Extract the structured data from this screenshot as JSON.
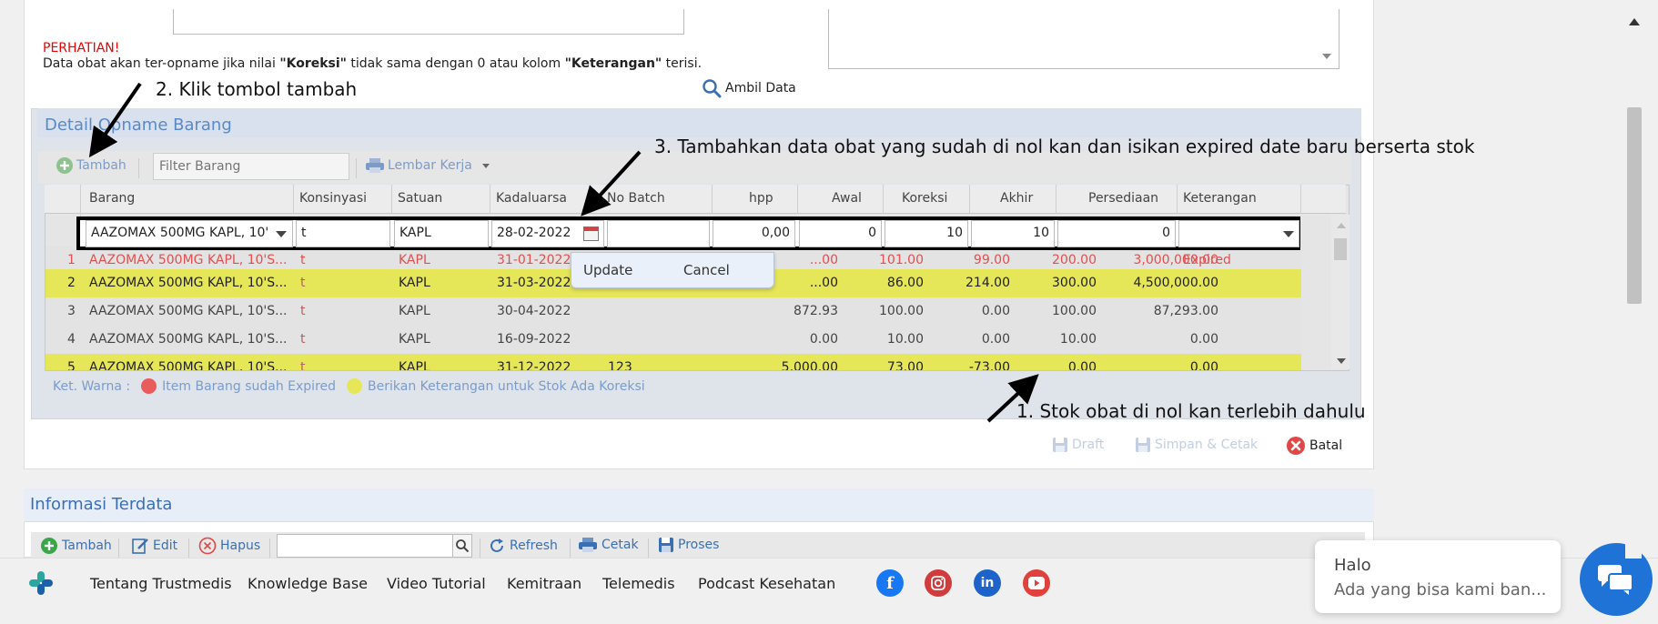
{
  "warning": {
    "title": "PERHATIAN!",
    "text_before": "Data obat akan ter-opname jika nilai ",
    "koreksi": "\"Koreksi\"",
    "text_mid": " tidak sama dengan 0 atau kolom ",
    "keterangan": "\"Keterangan\"",
    "text_after": " terisi."
  },
  "ambil_data_label": "Ambil Data",
  "detail": {
    "title": "Detail Opname Barang",
    "tambah_label": "Tambah",
    "filter_placeholder": "Filter Barang",
    "lembar_kerja_label": "Lembar Kerja"
  },
  "columns": [
    "Barang",
    "Konsinyasi",
    "Satuan",
    "Kadaluarsa",
    "No Batch",
    "hpp",
    "Awal",
    "Koreksi",
    "Akhir",
    "Persediaan",
    "Keterangan"
  ],
  "edit_row": {
    "barang": "AAZOMAX 500MG KAPL, 10'",
    "konsinyasi": "t",
    "satuan": "KAPL",
    "kadaluarsa": "28-02-2022",
    "no_batch": "",
    "hpp": "0,00",
    "awal": "0",
    "koreksi": "10",
    "akhir": "10",
    "persediaan": "0",
    "keterangan": ""
  },
  "popup": {
    "update": "Update",
    "cancel": "Cancel"
  },
  "rows": [
    {
      "no": "1",
      "barang": "AAZOMAX 500MG KAPL, 10'S...",
      "konsinyasi": "t",
      "satuan": "KAPL",
      "kadaluarsa": "31-01-2022",
      "no_batch": "",
      "hpp": "...00",
      "awal": "101.00",
      "koreksi": "99.00",
      "akhir": "200.00",
      "persediaan": "3,000,000.00",
      "keterangan": "Expired"
    },
    {
      "no": "2",
      "barang": "AAZOMAX 500MG KAPL, 10'S...",
      "konsinyasi": "t",
      "satuan": "KAPL",
      "kadaluarsa": "31-03-2022",
      "no_batch": "",
      "hpp": "...00",
      "awal": "86.00",
      "koreksi": "214.00",
      "akhir": "300.00",
      "persediaan": "4,500,000.00",
      "keterangan": ""
    },
    {
      "no": "3",
      "barang": "AAZOMAX 500MG KAPL, 10'S...",
      "konsinyasi": "t",
      "satuan": "KAPL",
      "kadaluarsa": "30-04-2022",
      "no_batch": "",
      "hpp": "872.93",
      "awal": "100.00",
      "koreksi": "0.00",
      "akhir": "100.00",
      "persediaan": "87,293.00",
      "keterangan": ""
    },
    {
      "no": "4",
      "barang": "AAZOMAX 500MG KAPL, 10'S...",
      "konsinyasi": "t",
      "satuan": "KAPL",
      "kadaluarsa": "16-09-2022",
      "no_batch": "",
      "hpp": "0.00",
      "awal": "10.00",
      "koreksi": "0.00",
      "akhir": "10.00",
      "persediaan": "0.00",
      "keterangan": ""
    },
    {
      "no": "5",
      "barang": "AAZOMAX 500MG KAPL, 10'S...",
      "konsinyasi": "t",
      "satuan": "KAPL",
      "kadaluarsa": "31-12-2022",
      "no_batch": "123",
      "hpp": "5,000.00",
      "awal": "73.00",
      "koreksi": "-73.00",
      "akhir": "0.00",
      "persediaan": "0.00",
      "keterangan": ""
    }
  ],
  "legend": {
    "prefix": "Ket. Warna :",
    "expired": "Item Barang sudah Expired",
    "koreksi": "Berikan Keterangan untuk Stok Ada Koreksi",
    "expired_color": "#e85c5c",
    "koreksi_color": "#e6e659"
  },
  "actions": {
    "draft": "Draft",
    "simpan": "Simpan & Cetak",
    "batal": "Batal"
  },
  "info": {
    "title": "Informasi Terdata",
    "tambah": "Tambah",
    "edit": "Edit",
    "hapus": "Hapus",
    "refresh": "Refresh",
    "cetak": "Cetak",
    "proses": "Proses"
  },
  "footer": {
    "links": [
      "Tentang Trustmedis",
      "Knowledge Base",
      "Video Tutorial",
      "Kemitraan",
      "Telemedis",
      "Podcast Kesehatan"
    ]
  },
  "chat": {
    "halo": "Halo",
    "message": "Ada yang bisa kami ban..."
  },
  "annotations": {
    "step1": "1. Stok obat di nol kan terlebih dahulu",
    "step2": "2. Klik tombol tambah",
    "step3": "3. Tambahkan data obat yang sudah di nol kan dan isikan expired date baru berserta stok"
  }
}
